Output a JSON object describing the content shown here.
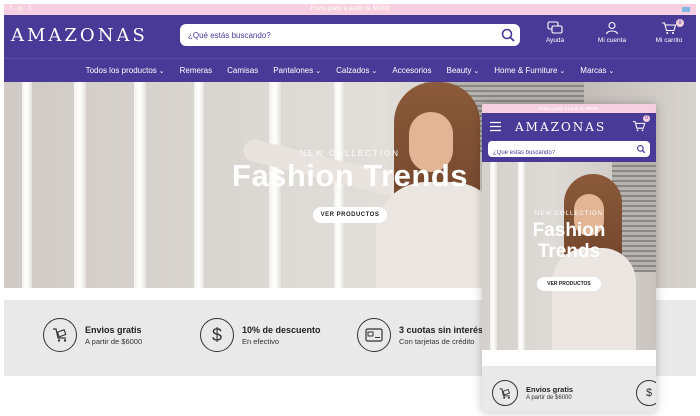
{
  "colors": {
    "brand": "#4a3a97",
    "topbar": "#f6cfe0",
    "benefits_bg": "#e9e9e9"
  },
  "desktop": {
    "topbar_text": "Envío gratis a partir de $6000",
    "logo": "AMAZONAS",
    "search": {
      "placeholder": "¿Qué estás buscando?",
      "icon": "search-icon"
    },
    "header_actions": [
      {
        "label": "Ayuda",
        "icon": "chat-icon"
      },
      {
        "label": "Mi cuenta",
        "icon": "user-icon"
      },
      {
        "label": "Mi carrito",
        "icon": "cart-icon",
        "badge": "0"
      }
    ],
    "nav": [
      {
        "label": "Todos los productos",
        "dropdown": true
      },
      {
        "label": "Remeras",
        "dropdown": false
      },
      {
        "label": "Camisas",
        "dropdown": false
      },
      {
        "label": "Pantalones",
        "dropdown": true
      },
      {
        "label": "Calzados",
        "dropdown": true
      },
      {
        "label": "Accesorios",
        "dropdown": false
      },
      {
        "label": "Beauty",
        "dropdown": true
      },
      {
        "label": "Home & Furniture",
        "dropdown": true
      },
      {
        "label": "Marcas",
        "dropdown": true
      }
    ],
    "hero": {
      "subtitle": "NEW COLLECTION",
      "title": "Fashion Trends",
      "button": "VER PRODUCTOS"
    },
    "benefits": [
      {
        "title": "Envios gratis",
        "subtitle": "A partir de $6000",
        "icon": "cart-icon"
      },
      {
        "title": "10% de descuento",
        "subtitle": "En efectivo",
        "icon": "dollar-icon"
      },
      {
        "title": "3 cuotas sin interés",
        "subtitle": "Con tarjetas de crédito",
        "icon": "credit-card-icon"
      }
    ]
  },
  "mobile": {
    "topbar_text": "Envío gratis a partir de $6000",
    "logo": "AMAZONAS",
    "cart_badge": "0",
    "search": {
      "placeholder": "¿Qué estás buscando?"
    },
    "hero": {
      "subtitle": "NEW COLLECTION",
      "title_line1": "Fashion",
      "title_line2": "Trends",
      "button": "VER PRODUCTOS"
    },
    "benefit": {
      "title": "Envios gratis",
      "subtitle": "A partir de $6000"
    },
    "benefit2_symbol": "$"
  }
}
